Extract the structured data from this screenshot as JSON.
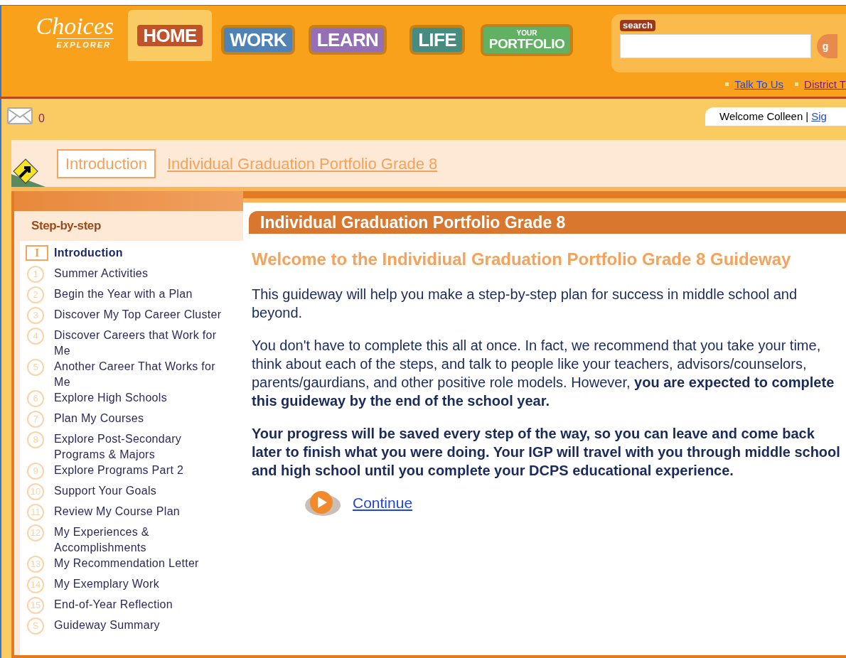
{
  "logo": {
    "name": "Choices",
    "sub": "EXPLORER"
  },
  "tabs": [
    {
      "label": "HOME",
      "selected": true,
      "color": "#c0522a"
    },
    {
      "label": "WORK",
      "selected": false,
      "color": "#4f82b5"
    },
    {
      "label": "LEARN",
      "selected": false,
      "color": "#956fb5"
    },
    {
      "label": "LIFE",
      "selected": false,
      "color": "#478c80"
    },
    {
      "label": "PORTFOLIO",
      "top": "YOUR",
      "selected": false,
      "color": "#62b063"
    }
  ],
  "search": {
    "label": "search",
    "button": "g"
  },
  "top_links": [
    "Talk To Us",
    "District T"
  ],
  "mail": {
    "count": "0"
  },
  "welcome": {
    "text": "Welcome Colleen",
    "separator": "|",
    "link": "Sig"
  },
  "breadcrumb": {
    "current": "Introduction",
    "link": "Individual Graduation Portfolio Grade 8"
  },
  "sidebar": {
    "title": "Step-by-step",
    "steps": [
      {
        "marker": "I",
        "label": "Introduction",
        "selected": true
      },
      {
        "marker": "1",
        "label": "Summer Activities",
        "selected": false
      },
      {
        "marker": "2",
        "label": "Begin the Year with a Plan",
        "selected": false
      },
      {
        "marker": "3",
        "label": "Discover My Top Career Cluster",
        "selected": false
      },
      {
        "marker": "4",
        "label": "Discover Careers that Work for Me",
        "selected": false
      },
      {
        "marker": "5",
        "label": "Another Career That Works for Me",
        "selected": false
      },
      {
        "marker": "6",
        "label": "Explore High Schools",
        "selected": false
      },
      {
        "marker": "7",
        "label": "Plan My Courses",
        "selected": false
      },
      {
        "marker": "8",
        "label": "Explore Post-Secondary Programs & Majors",
        "selected": false
      },
      {
        "marker": "9",
        "label": "Explore Programs Part 2",
        "selected": false
      },
      {
        "marker": "10",
        "label": "Support Your Goals",
        "selected": false
      },
      {
        "marker": "11",
        "label": "Review My Course Plan",
        "selected": false
      },
      {
        "marker": "12",
        "label": "My Experiences & Accomplishments",
        "selected": false
      },
      {
        "marker": "13",
        "label": "My Recommendation Letter",
        "selected": false
      },
      {
        "marker": "14",
        "label": "My Exemplary Work",
        "selected": false
      },
      {
        "marker": "15",
        "label": "End-of-Year Reflection",
        "selected": false
      },
      {
        "marker": "S",
        "label": "Guideway Summary",
        "selected": false
      }
    ]
  },
  "main": {
    "title": "Individual Graduation Portfolio Grade 8",
    "heading": "Welcome to the Individiual Graduation Portfolio Grade 8 Guideway",
    "paragraphs": [
      {
        "text": "This guideway will help you make a step-by-step plan for success in middle school and beyond.",
        "bold": false
      },
      {
        "text": "You don't have to complete this all at once. In fact, we recommend that you take your time, think about each of the steps, and talk to people like your teachers, advisors/counselors, parents/gaurdians, and other positive role models. However, **you are expected to complete this guideway by the end of the school year.**",
        "bold": false
      },
      {
        "text": "Your progress will be saved every step of the way, so you can leave and come back later to finish what you were doing. Your IGP will travel with you through middle school and high school until you complete your DCPS educational experience.",
        "bold": true
      }
    ],
    "continue": "Continue"
  }
}
